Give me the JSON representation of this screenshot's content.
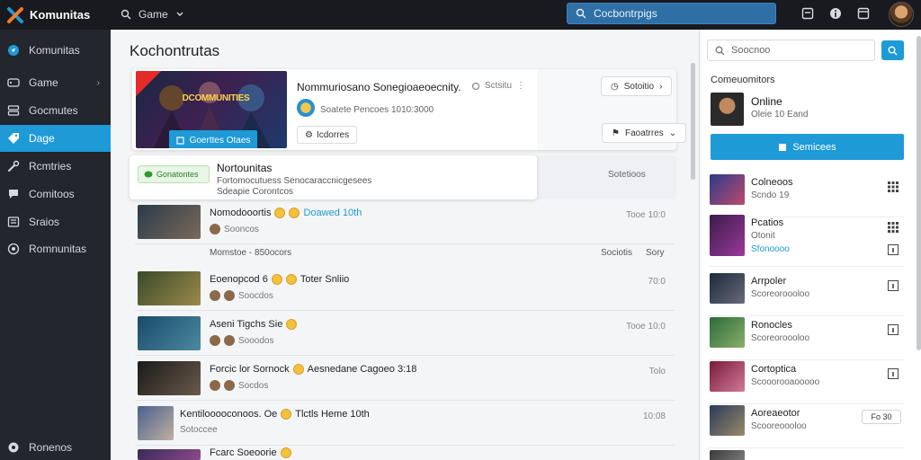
{
  "topbar": {
    "app_name": "Komunitas",
    "game_menu": "Game",
    "search_placeholder": "Cocbontrpigs"
  },
  "sidebar": {
    "items": [
      {
        "label": "Komunitas",
        "icon": "compass-icon"
      },
      {
        "label": "Game",
        "icon": "gamepad-icon",
        "has_chevron": true
      },
      {
        "label": "Gocmutes",
        "icon": "storage-icon"
      },
      {
        "label": "Dage",
        "icon": "tag-icon",
        "active": true
      },
      {
        "label": "Rcmtries",
        "icon": "wrench-icon"
      },
      {
        "label": "Comitoos",
        "icon": "chat-icon"
      },
      {
        "label": "Sraios",
        "icon": "grid-icon"
      },
      {
        "label": "Romnunitas",
        "icon": "globe-icon"
      }
    ],
    "footer_label": "Ronenos"
  },
  "main": {
    "title": "Kochontrutas",
    "feature": {
      "banner_title": "DCOMMUNITIES",
      "banner_button": "Goerttes Otaes",
      "title": "Nommuriosano Sonegioaeoecnity.",
      "meta": "Sctsitu",
      "subtitle": "Soatete Pencoes 1010:3000",
      "button": "Icdorres",
      "pill_top": "Sotoitio",
      "pill_bottom": "Faoatrres"
    },
    "notice": {
      "badge": "Gonatontes",
      "title": "Nortounitas",
      "line1": "Fortomocutuess Senocaraccnicgesees",
      "line2": "Sdeapie Corontcos",
      "right": "Sotetioos"
    },
    "feed": [
      {
        "title": "Nomodooortis",
        "extra": "Doawed 10th",
        "sub": "Sooncos",
        "time": "Tooe 10:0",
        "thumb": "#4a5a6a"
      },
      {
        "title": "Eoenopcod 6",
        "extra": "Toter Snliio",
        "sub": "Soocdos",
        "time": "70:0",
        "thumb": "#5a6a3a"
      },
      {
        "title": "Aseni Tigchs Sie",
        "extra": "",
        "sub": "Sooodos",
        "time": "Tooe 10:0",
        "thumb": "#2a5a70"
      },
      {
        "title": "Forcic lor Sornock",
        "extra": "Aesnedane Cagoeo 3:18",
        "sub": "Socdos",
        "time": "Tolo",
        "thumb": "#3a2a2a"
      },
      {
        "title": "Kentilooooconoos. Oe",
        "extra": "Tlctls Heme 10th",
        "sub": "Sotoccee",
        "time": "10:08",
        "thumb": "#4a6090"
      },
      {
        "title": "Fcarc Soeoorie",
        "extra": "",
        "sub": "",
        "time": "",
        "thumb": "#3a2a5a"
      }
    ],
    "meta_row": {
      "left": "Momstoe - 850ocors",
      "right1": "Sociotis",
      "right2": "Sory"
    }
  },
  "right_panel": {
    "search_placeholder": "Soocnoo",
    "section_title": "Comeuomitors",
    "online": {
      "name": "Online",
      "sub": "Oleie 10 Eand"
    },
    "big_button": "Semicees",
    "items": [
      {
        "name": "Colneoos",
        "sub": "Scndo 19",
        "action": "grid-icon",
        "thumb": "#3a4a9a"
      },
      {
        "name": "Pcatios",
        "sub": "Otonit",
        "sub2": "Sfonoooo",
        "action": "grid-icon",
        "thumb": "#5a2a6a"
      },
      {
        "name": "Arrpoler",
        "sub": "Scoreoroooloo",
        "action": "info-icon",
        "thumb": "#2a3a50"
      },
      {
        "name": "Ronocles",
        "sub": "Scoreoroooloo",
        "action": "info-icon",
        "thumb": "#3a7a4a"
      },
      {
        "name": "Cortoptica",
        "sub": "Scooorooaooooo",
        "action": "info-icon",
        "thumb": "#8a2a4a"
      },
      {
        "name": "Aoreaeotor",
        "sub": "Scooreoooloo",
        "pill": "Fo 30",
        "thumb": "#3a4a6a"
      }
    ]
  },
  "colors": {
    "accent": "#1e9ad6",
    "sidebar_bg": "#23262d",
    "topbar_bg": "#181a1f"
  }
}
